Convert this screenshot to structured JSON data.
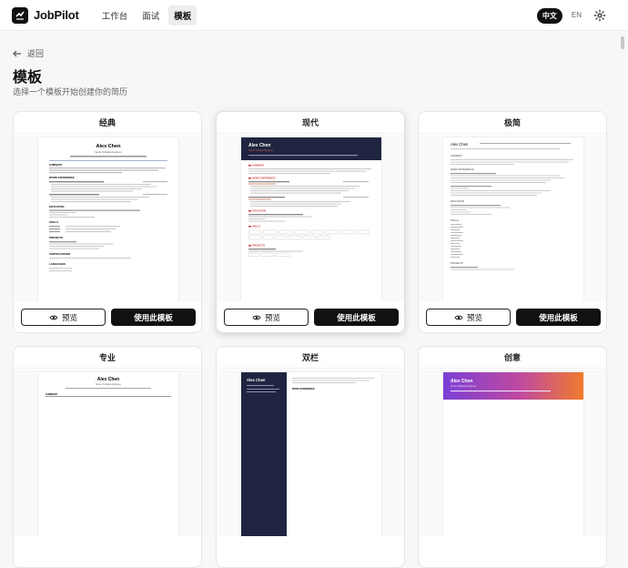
{
  "app": {
    "name": "JobPilot"
  },
  "nav": [
    {
      "label": "工作台"
    },
    {
      "label": "面试"
    },
    {
      "label": "模板"
    }
  ],
  "lang": {
    "zh": "中文",
    "en": "EN"
  },
  "back": "返回",
  "page": {
    "title": "模板",
    "subtitle": "选择一个模板开始创建你的简历"
  },
  "templates": [
    {
      "name": "经典"
    },
    {
      "name": "现代"
    },
    {
      "name": "极简"
    },
    {
      "name": "专业"
    },
    {
      "name": "双栏"
    },
    {
      "name": "创意"
    }
  ],
  "actions": {
    "preview": "预览",
    "use": "使用此模板"
  },
  "resume": {
    "name": "Alex Chen",
    "role": "Senior Software Engineer",
    "contact": "alex@example.com · +1 (555) 867-5309 · San Francisco, CA · linkedin.com/in/alexchen",
    "sections": {
      "summary": "SUMMARY",
      "experience": "WORK EXPERIENCE",
      "education": "EDUCATION",
      "skills": "SKILLS",
      "projects": "PROJECTS",
      "certs": "CERTIFICATIONS",
      "languages": "LANGUAGES"
    }
  },
  "colors": {
    "dark": "#111111",
    "accent_red": "#d23b3b",
    "navy": "#1f2540",
    "gradient_a": "#7b3fd6",
    "gradient_b": "#f07a2c"
  }
}
